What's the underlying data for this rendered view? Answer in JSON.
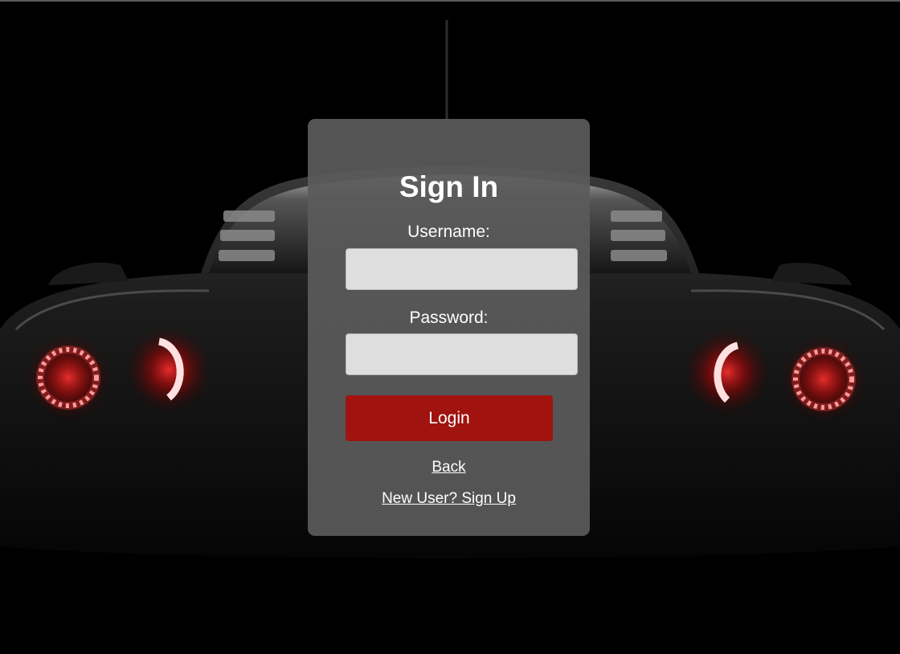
{
  "page": {
    "background": "#000000",
    "accent": "#a0130f",
    "card_color": "#5a5a5a"
  },
  "signin": {
    "title": "Sign In",
    "username_label": "Username:",
    "username_value": "",
    "username_placeholder": "",
    "password_label": "Password:",
    "password_value": "",
    "password_placeholder": "",
    "login_label": "Login",
    "back_link": "Back",
    "signup_link": "New User? Sign Up"
  },
  "background_image": {
    "subject": "dark sports car rear view with red ring tail lights",
    "taillight_color": "#ff2a2a"
  }
}
